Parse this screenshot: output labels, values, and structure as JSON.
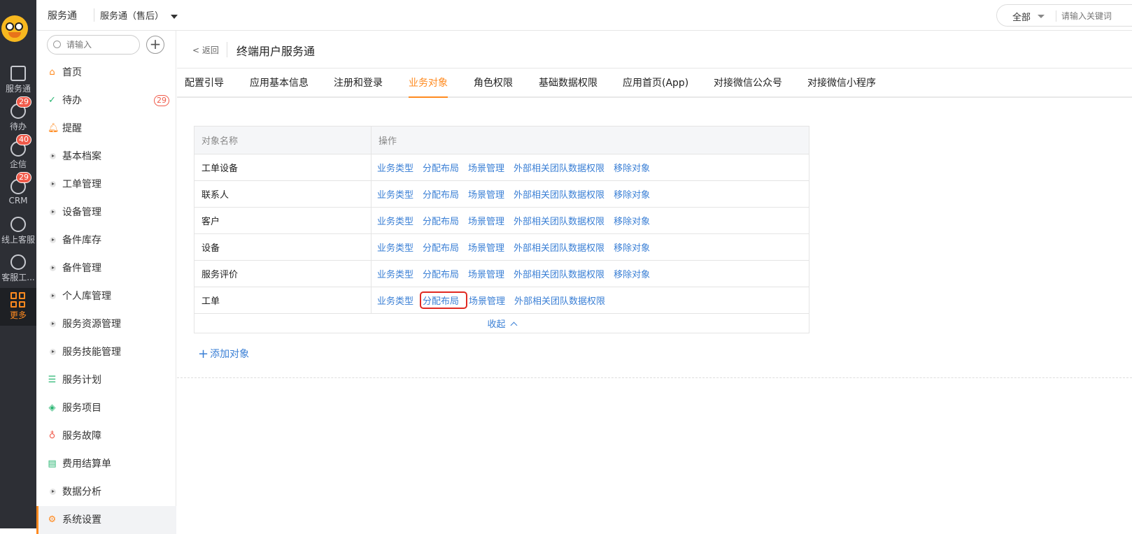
{
  "rail": {
    "items": [
      {
        "label": "服务通",
        "icon": "clipboard-gear-icon"
      },
      {
        "label": "待办",
        "icon": "check-circle-icon",
        "badge": "29"
      },
      {
        "label": "企信",
        "icon": "chat-bubble-icon",
        "badge": "40"
      },
      {
        "label": "CRM",
        "icon": "clock-icon",
        "badge": "29"
      },
      {
        "label": "线上客服",
        "icon": "smile-chat-icon"
      },
      {
        "label": "客服工...",
        "icon": "headset-icon"
      },
      {
        "label": "更多",
        "icon": "grid-icon"
      }
    ]
  },
  "topbar": {
    "app_name": "服务通",
    "app_switch": "服务通（售后）",
    "search_scope": "全部",
    "search_placeholder": "请输入关键词"
  },
  "sidebar": {
    "search_placeholder": "请输入",
    "items": [
      {
        "label": "首页",
        "icon": "home-icon"
      },
      {
        "label": "待办",
        "icon": "check-circle-icon",
        "badge": "29"
      },
      {
        "label": "提醒",
        "icon": "bell-icon"
      },
      {
        "label": "基本档案",
        "icon": "expand-triangle-icon"
      },
      {
        "label": "工单管理",
        "icon": "expand-triangle-icon"
      },
      {
        "label": "设备管理",
        "icon": "expand-triangle-icon"
      },
      {
        "label": "备件库存",
        "icon": "expand-triangle-icon"
      },
      {
        "label": "备件管理",
        "icon": "expand-triangle-icon"
      },
      {
        "label": "个人库管理",
        "icon": "expand-triangle-icon"
      },
      {
        "label": "服务资源管理",
        "icon": "expand-triangle-icon"
      },
      {
        "label": "服务技能管理",
        "icon": "expand-triangle-icon"
      },
      {
        "label": "服务计划",
        "icon": "document-list-icon"
      },
      {
        "label": "服务项目",
        "icon": "layers-icon"
      },
      {
        "label": "服务故障",
        "icon": "lightbulb-icon"
      },
      {
        "label": "费用结算单",
        "icon": "receipt-icon"
      },
      {
        "label": "数据分析",
        "icon": "expand-triangle-icon"
      },
      {
        "label": "系统设置",
        "icon": "gear-icon"
      }
    ]
  },
  "page": {
    "back": "返回",
    "title": "终端用户服务通",
    "tabs": [
      "配置引导",
      "应用基本信息",
      "注册和登录",
      "业务对象",
      "角色权限",
      "基础数据权限",
      "应用首页(App)",
      "对接微信公众号",
      "对接微信小程序"
    ],
    "active_tab": "业务对象"
  },
  "table": {
    "headers": [
      "对象名称",
      "操作"
    ],
    "rows": [
      {
        "name": "工单设备",
        "ops": [
          "业务类型",
          "分配布局",
          "场景管理",
          "外部相关团队数据权限",
          "移除对象"
        ]
      },
      {
        "name": "联系人",
        "ops": [
          "业务类型",
          "分配布局",
          "场景管理",
          "外部相关团队数据权限",
          "移除对象"
        ]
      },
      {
        "name": "客户",
        "ops": [
          "业务类型",
          "分配布局",
          "场景管理",
          "外部相关团队数据权限",
          "移除对象"
        ]
      },
      {
        "name": "设备",
        "ops": [
          "业务类型",
          "分配布局",
          "场景管理",
          "外部相关团队数据权限",
          "移除对象"
        ]
      },
      {
        "name": "服务评价",
        "ops": [
          "业务类型",
          "分配布局",
          "场景管理",
          "外部相关团队数据权限",
          "移除对象"
        ]
      },
      {
        "name": "工单",
        "ops": [
          "业务类型",
          "分配布局",
          "场景管理",
          "外部相关团队数据权限"
        ]
      }
    ],
    "collapse": "收起",
    "add_object": "添加对象"
  },
  "colors": {
    "accent": "#ff8a1f",
    "link": "#3a7fd5",
    "badge": "#f05a4a",
    "highlight": "#e02a22"
  }
}
